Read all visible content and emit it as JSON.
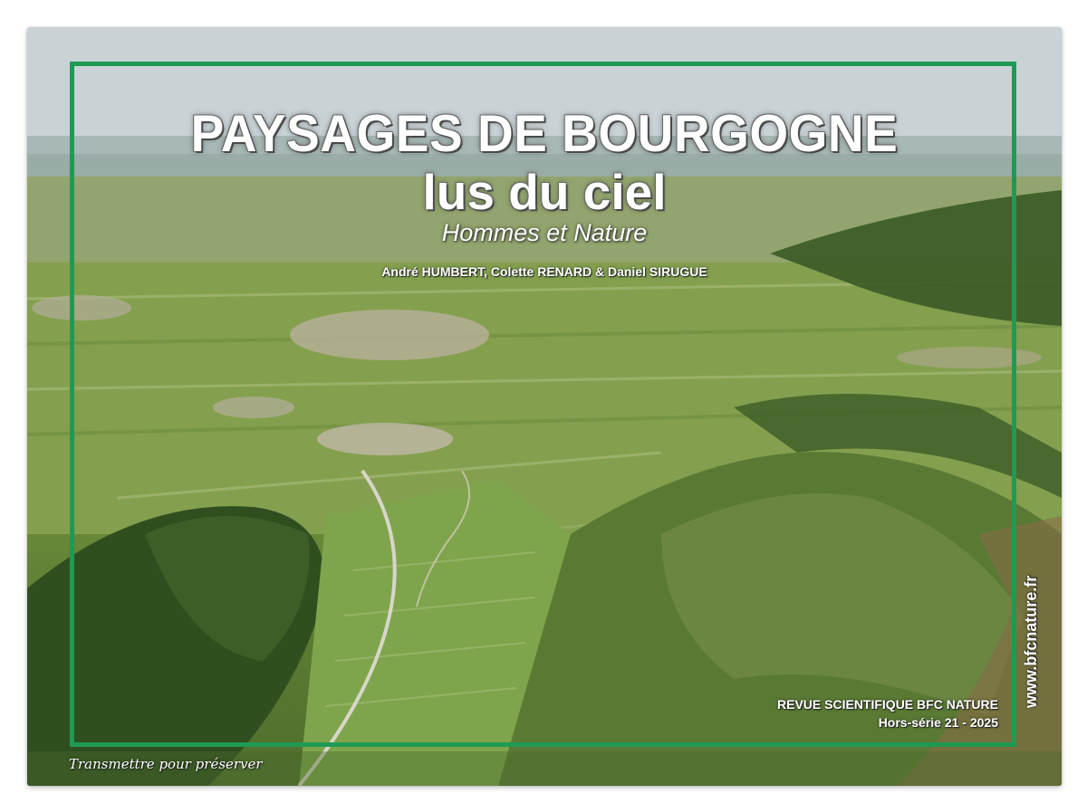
{
  "cover": {
    "title_line1": "PAYSAGES DE BOURGOGNE",
    "title_line2": "lus du ciel",
    "subtitle": "Hommes et Nature",
    "authors": "André HUMBERT, Colette RENARD & Daniel SIRUGUE",
    "revue_line1": "REVUE SCIENTIFIQUE BFC NATURE",
    "revue_line2": "Hors-série 21 - 2025",
    "website": "www.bfcnature.fr",
    "tagline": "Transmettre pour préserver"
  },
  "colors": {
    "frame_green": "#1f9a55",
    "title_white": "#ffffff",
    "sky": "#cfd7dc",
    "vineyard_green": "#7e9a47",
    "forest_dark": "#3b5a26"
  },
  "photo": {
    "description_icon": "aerial-landscape-image"
  }
}
